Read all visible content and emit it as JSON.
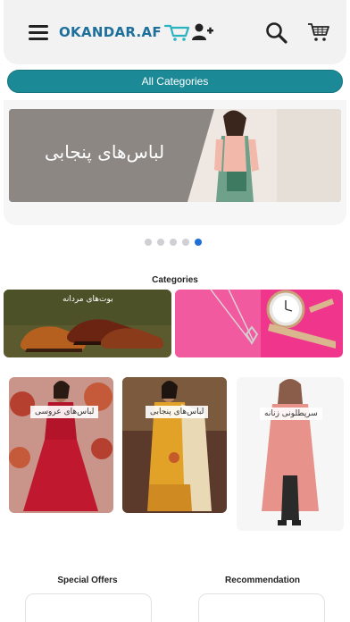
{
  "header": {
    "logo_text": "OKANDAR.AF",
    "icons": [
      "menu-icon",
      "add-user-icon",
      "search-icon",
      "cart-icon"
    ]
  },
  "categories_button": {
    "label": "All Categories",
    "color": "#1c8a96"
  },
  "banner": {
    "text": "لباس‌های پنجابی",
    "slides_total": 5,
    "active_slide": 5
  },
  "categories_section": {
    "title": "Categories",
    "tiles": [
      {
        "label": "بوت‌های مردانه"
      },
      {
        "label": ""
      }
    ]
  },
  "products": [
    {
      "label": "لباس‌های عروسی"
    },
    {
      "label": "لباس‌های پنجابی"
    },
    {
      "label": "سرپطلونی زنانه"
    }
  ],
  "bottom_sections": {
    "special_offers": "Special Offers",
    "recommendation": "Recommendation"
  }
}
